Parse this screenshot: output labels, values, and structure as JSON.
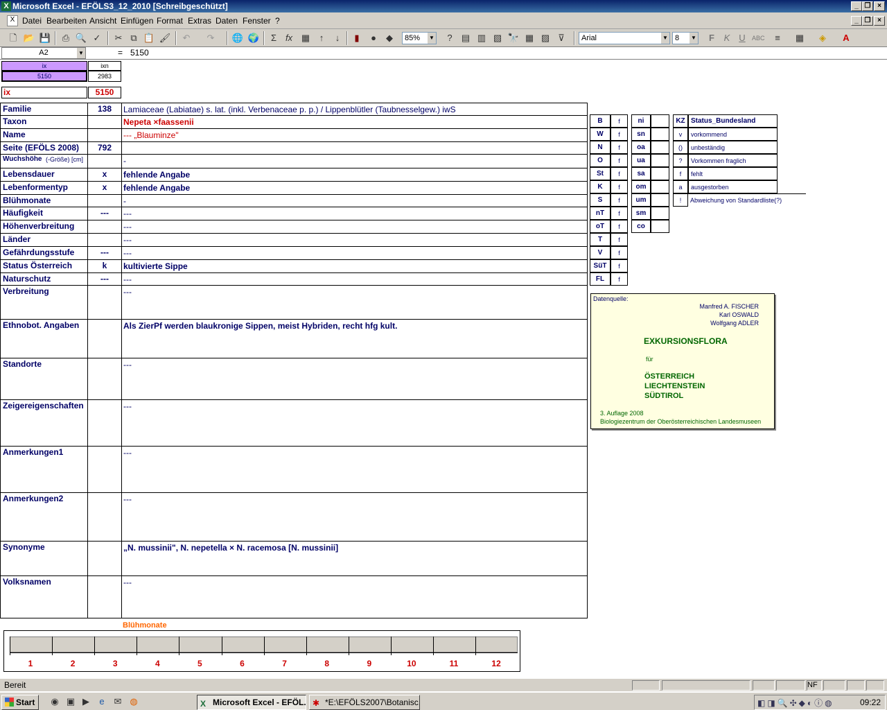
{
  "window": {
    "title": "Microsoft Excel - EFÖLS3_12_2010  [Schreibgeschützt]"
  },
  "menu": [
    "Datei",
    "Bearbeiten",
    "Ansicht",
    "Einfügen",
    "Format",
    "Extras",
    "Daten",
    "Fenster",
    "?"
  ],
  "toolbar": {
    "zoom": "85%",
    "font": "Arial",
    "size": "8"
  },
  "formula": {
    "namebox": "A2",
    "eq": "=",
    "value": "5150"
  },
  "header": {
    "ix_head": "ix",
    "ixn_head": "ixn",
    "ix_val": "5150",
    "ixn_val": "2983",
    "ix_label": "ix",
    "ix_big": "5150"
  },
  "rows": [
    {
      "label": "Familie",
      "code": "138",
      "value": "Lamiaceae (Labiatae) s. lat. (inkl. Verbenaceae p. p.)  /  Lippenblütler (Taubnesselgew.) iwS"
    },
    {
      "label": "Taxon",
      "code": "",
      "value": "Nepeta ×faassenii"
    },
    {
      "label": "Name",
      "code": "",
      "value": "---  „Blauminze\""
    },
    {
      "label": "Seite (EFÖLS 2008)",
      "code": "792",
      "value": ""
    },
    {
      "label": "Wuchshöhe",
      "label2": "(-Größe) [cm]",
      "code": "",
      "value": " -"
    },
    {
      "label": "Lebensdauer",
      "code": "x",
      "value": "fehlende Angabe"
    },
    {
      "label": "Lebenformentyp",
      "code": "x",
      "value": "fehlende Angabe"
    },
    {
      "label": "Blühmonate",
      "code": "",
      "value": " -"
    },
    {
      "label": "Häufigkeit",
      "code": "---",
      "value": "---"
    },
    {
      "label": "Höhenverbreitung",
      "code": "",
      "value": "---"
    },
    {
      "label": "Länder",
      "code": "",
      "value": "---"
    },
    {
      "label": "Gefährdungsstufe",
      "code": "---",
      "value": "  ---"
    },
    {
      "label": "Status Österreich",
      "code": "k",
      "value": "kultivierte Sippe"
    },
    {
      "label": "Naturschutz",
      "code": "---",
      "value": "---"
    },
    {
      "label": "Verbreitung",
      "code": "",
      "value": "---"
    },
    {
      "label": "Ethnobot. Angaben",
      "code": "",
      "value": "Als ZierPf  werden blaukronige Sippen, meist Hybriden, recht hfg kult."
    },
    {
      "label": "Standorte",
      "code": "",
      "value": "---"
    },
    {
      "label": "Zeigereigenschaften",
      "code": "",
      "value": "---"
    },
    {
      "label": "Anmerkungen1",
      "code": "",
      "value": "---"
    },
    {
      "label": "Anmerkungen2",
      "code": "",
      "value": "---"
    },
    {
      "label": "Synonyme",
      "code": "",
      "value": "„N. mussinii\", N. nepetella × N. racemosa [N. mussinii]"
    },
    {
      "label": "Volksnamen",
      "code": "",
      "value": "---"
    }
  ],
  "status_codes": [
    {
      "k": "B",
      "v": "f"
    },
    {
      "k": "W",
      "v": "f"
    },
    {
      "k": "N",
      "v": "f"
    },
    {
      "k": "O",
      "v": "f"
    },
    {
      "k": "St",
      "v": "f"
    },
    {
      "k": "K",
      "v": "f"
    },
    {
      "k": "S",
      "v": "f"
    },
    {
      "k": "nT",
      "v": "f"
    },
    {
      "k": "oT",
      "v": "f"
    },
    {
      "k": "T",
      "v": "f"
    },
    {
      "k": "V",
      "v": "f"
    },
    {
      "k": "SüT",
      "v": "f"
    },
    {
      "k": "FL",
      "v": "f"
    }
  ],
  "regions": [
    "ni",
    "sn",
    "oa",
    "ua",
    "sa",
    "om",
    "um",
    "sm",
    "co"
  ],
  "legend": {
    "head_k": "KZ",
    "head_v": "Status_Bundesland",
    "items": [
      {
        "k": "v",
        "v": "vorkommend"
      },
      {
        "k": "()",
        "v": "unbeständig"
      },
      {
        "k": "?",
        "v": "Vorkommen fraglich"
      },
      {
        "k": "f",
        "v": "fehlt"
      },
      {
        "k": "a",
        "v": "ausgestorben"
      },
      {
        "k": "!",
        "v": "Abweichung von Standardliste(?)"
      }
    ]
  },
  "source": {
    "label": "Datenquelle:",
    "authors": [
      "Manfred A. FISCHER",
      "Karl OSWALD",
      "Wolfgang ADLER"
    ],
    "title": "EXKURSIONSFLORA",
    "fuer": "für",
    "countries": [
      "ÖSTERREICH",
      "LIECHTENSTEIN",
      "SÜDTIROL"
    ],
    "edition": "3. Auflage 2008",
    "publisher": "Biologiezentrum der Oberösterreichischen Landesmuseen"
  },
  "bloom": {
    "title": "Blühmonate",
    "months": [
      "1",
      "2",
      "3",
      "4",
      "5",
      "6",
      "7",
      "8",
      "9",
      "10",
      "11",
      "12"
    ]
  },
  "statusbar": {
    "text": "Bereit",
    "nf": "NF"
  },
  "taskbar": {
    "start": "Start",
    "items": [
      "Microsoft Excel - EFÖL...",
      "*E:\\EFÖLS2007\\Botanisc..."
    ],
    "clock": "09:22"
  }
}
